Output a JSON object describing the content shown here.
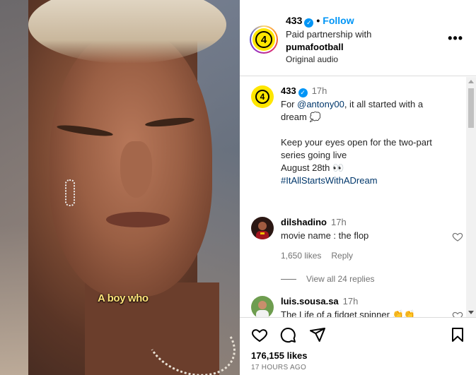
{
  "media": {
    "subtitle": "A boy who"
  },
  "header": {
    "username": "433",
    "separator": "•",
    "follow_label": "Follow",
    "partnership_label": "Paid partnership with",
    "partner": "pumafootball",
    "audio": "Original audio",
    "more_label": "•••"
  },
  "caption": {
    "username": "433",
    "time": "17h",
    "line1_prefix": "For ",
    "mention": "@antony00",
    "line1_suffix": ", it all started with a dream 💭",
    "line2": "Keep your eyes open for the two-part series going live",
    "line3": "August 28th 👀",
    "hashtag": "#ItAllStartsWithADream"
  },
  "comments": [
    {
      "username": "dilshadino",
      "time": "17h",
      "text": "movie name : the flop",
      "likes": "1,650 likes",
      "reply_label": "Reply",
      "view_replies": "View all 24 replies"
    },
    {
      "username": "luis.sousa.sa",
      "time": "17h",
      "text": "The Life of a fidget spinner 👏👏"
    }
  ],
  "footer": {
    "likes": "176,155 likes",
    "posted": "17 HOURS AGO"
  },
  "colors": {
    "accent": "#0095f6",
    "brand_yellow": "#ffe600",
    "muted": "#737373",
    "link": "#00376b"
  },
  "icons": {
    "like": "heart-icon",
    "comment": "comment-icon",
    "share": "share-icon",
    "save": "bookmark-icon",
    "verified": "verified-icon",
    "more": "more-icon"
  }
}
